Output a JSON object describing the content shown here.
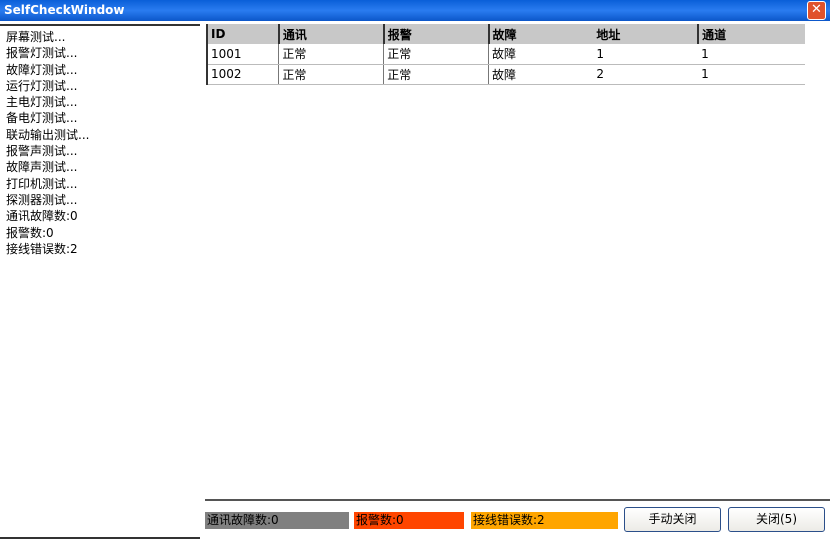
{
  "window": {
    "title": "SelfCheckWindow",
    "close_icon": "close-icon"
  },
  "tests": [
    "屏幕测试...",
    "报警灯测试...",
    "故障灯测试...",
    "运行灯测试...",
    "主电灯测试...",
    "备电灯测试...",
    "联动输出测试...",
    "报警声测试...",
    "故障声测试...",
    "打印机测试...",
    "探测器测试...",
    "通讯故障数:0",
    "报警数:0",
    "接线错误数:2"
  ],
  "table": {
    "headers": [
      "ID",
      "通讯",
      "报警",
      "故障",
      "地址",
      "通道"
    ],
    "rows": [
      [
        "1001",
        "正常",
        "正常",
        "故障",
        "1",
        "1"
      ],
      [
        "1002",
        "正常",
        "正常",
        "故障",
        "2",
        "1"
      ]
    ]
  },
  "status": {
    "comm_fault": "通讯故障数:0",
    "alarm": "报警数:0",
    "wiring_error": "接线错误数:2",
    "colors": {
      "comm_fault": "#808080",
      "alarm": "#ff4500",
      "wiring_error": "#ffa500"
    }
  },
  "buttons": {
    "manual_close": "手动关闭",
    "close": "关闭(5)"
  }
}
